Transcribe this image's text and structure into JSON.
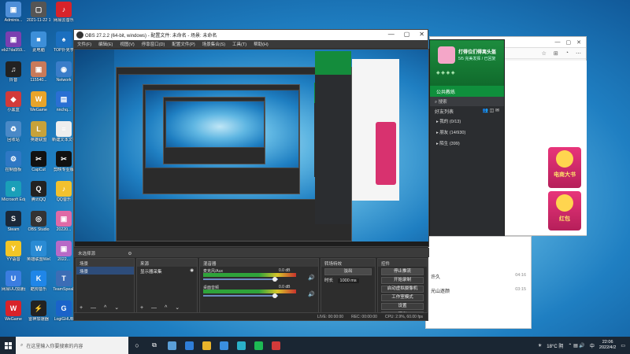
{
  "desktop": {
    "icons": [
      {
        "label": "Adminis...",
        "color": "#4f8fd8",
        "glyph": "▣"
      },
      {
        "label": "2021-11-22 16:15:56...",
        "color": "#555",
        "glyph": "▢"
      },
      {
        "label": "网易云音乐",
        "color": "#d8232a",
        "glyph": "♪"
      },
      {
        "label": "eb27da959...",
        "color": "#7b3fb0",
        "glyph": "▣"
      },
      {
        "label": "此电脑",
        "color": "#3d8fd9",
        "glyph": "■"
      },
      {
        "label": "TOP扑克学",
        "color": "#1b6fbf",
        "glyph": "♠"
      },
      {
        "label": "抖音",
        "color": "#222",
        "glyph": "♫"
      },
      {
        "label": "115540...",
        "color": "#c87a5a",
        "glyph": "▣"
      },
      {
        "label": "Network",
        "color": "#3a7dc9",
        "glyph": "◉"
      },
      {
        "label": "小黑盒",
        "color": "#d23a3a",
        "glyph": "◆"
      },
      {
        "label": "WeGame",
        "color": "#e8a42a",
        "glyph": "W"
      },
      {
        "label": "nnchq...",
        "color": "#2a6fd3",
        "glyph": "▤"
      },
      {
        "label": "回收站",
        "color": "#4a89c7",
        "glyph": "♻"
      },
      {
        "label": "英雄联盟",
        "color": "#c7a23a",
        "glyph": "L"
      },
      {
        "label": "新建文本文档",
        "color": "#eee",
        "glyph": "≡"
      },
      {
        "label": "控制面板",
        "color": "#2f78c4",
        "glyph": "⚙"
      },
      {
        "label": "CapCut",
        "color": "#111",
        "glyph": "✂"
      },
      {
        "label": "剪映专业版",
        "color": "#111",
        "glyph": "✂"
      },
      {
        "label": "Microsoft Edge",
        "color": "#1a9fb8",
        "glyph": "e"
      },
      {
        "label": "腾讯QQ",
        "color": "#222",
        "glyph": "Q"
      },
      {
        "label": "QQ音乐",
        "color": "#f2c12e",
        "glyph": "♪"
      },
      {
        "label": "Steam",
        "color": "#1b2838",
        "glyph": "S"
      },
      {
        "label": "OBS Studio",
        "color": "#333",
        "glyph": "◎"
      },
      {
        "label": "20220...",
        "color": "#e06aa6",
        "glyph": "▣"
      },
      {
        "label": "YY语音",
        "color": "#f3c526",
        "glyph": "Y"
      },
      {
        "label": "英雄联盟WeGame版",
        "color": "#2a8bd4",
        "glyph": "W"
      },
      {
        "label": "2022...",
        "color": "#b86ac7",
        "glyph": "▣"
      },
      {
        "label": "网易UU加速器",
        "color": "#3b7de0",
        "glyph": "U"
      },
      {
        "label": "酷狗音乐",
        "color": "#1f86e8",
        "glyph": "K"
      },
      {
        "label": "TeamSpeak",
        "color": "#3c6db5",
        "glyph": "T"
      },
      {
        "label": "WeGame",
        "color": "#d8232a",
        "glyph": "W"
      },
      {
        "label": "雷神加速器",
        "color": "#222",
        "glyph": "⚡"
      },
      {
        "label": "LogiGHUB",
        "color": "#1a63c9",
        "glyph": "G"
      }
    ]
  },
  "obs": {
    "title": "OBS 27.2.2 (64-bit, windows) - 配置文件: 未命名 - 场景: 未命名",
    "menu": [
      "文件(F)",
      "编辑(E)",
      "视图(V)",
      "停靠窗口(D)",
      "配置文件(P)",
      "场景集合(S)",
      "工具(T)",
      "帮助(H)"
    ],
    "context_bar": "未选择源",
    "scenes_header": "场景",
    "scenes": [
      "场景"
    ],
    "sources_header": "来源",
    "sources": [
      "显示器采集"
    ],
    "mixer_header": "混音器",
    "mixer": [
      {
        "name": "麦克风/Aux",
        "db": "0.0 dB"
      },
      {
        "name": "桌面音频",
        "db": "0.0 dB"
      }
    ],
    "transitions_header": "转场特效",
    "transition_type": "淡出",
    "duration_label": "时长",
    "duration_value": "1000 ms",
    "controls_header": "控件",
    "controls": [
      "停止推流",
      "开始录制",
      "启动虚拟摄像机",
      "工作室模式",
      "设置",
      "退出"
    ],
    "status": [
      "LIVE: 00:00:00",
      "REC: 00:00:00",
      "CPU: 2.9%, 60.00 fps"
    ],
    "dock_footer": "+ — ^ ⌄"
  },
  "qq": {
    "name": "打得位们得离头盔",
    "signature": "5/5 完美发挥 / 已回复",
    "section": "公共教练",
    "search": "搜索",
    "tools_label": "好友列表",
    "groups": [
      "▸ 我的 (0/13)",
      "▸ 朋友 (14/930)",
      "▸ 陌生 (399)"
    ]
  },
  "chat": {
    "rows": [
      {
        "name": "许久",
        "time": "04:16"
      },
      {
        "name": "光山逐颜",
        "time": "03:15"
      },
      {
        "name": "",
        "time": ""
      }
    ]
  },
  "browser": {
    "ad1": "电商大书",
    "ad2": "红包"
  },
  "taskbar": {
    "search_placeholder": "在这里输入你要搜索的内容",
    "weather": "18°C 阴",
    "ime": "中",
    "time": "22:06",
    "date": "2022/4/2",
    "apps": [
      {
        "color": "#5a9fd8"
      },
      {
        "color": "#2f7ed8"
      },
      {
        "color": "#e9b42b"
      },
      {
        "color": "#3a8fe0"
      },
      {
        "color": "#2ab1c9"
      },
      {
        "color": "#1db954"
      },
      {
        "color": "#d23a3a"
      }
    ]
  }
}
